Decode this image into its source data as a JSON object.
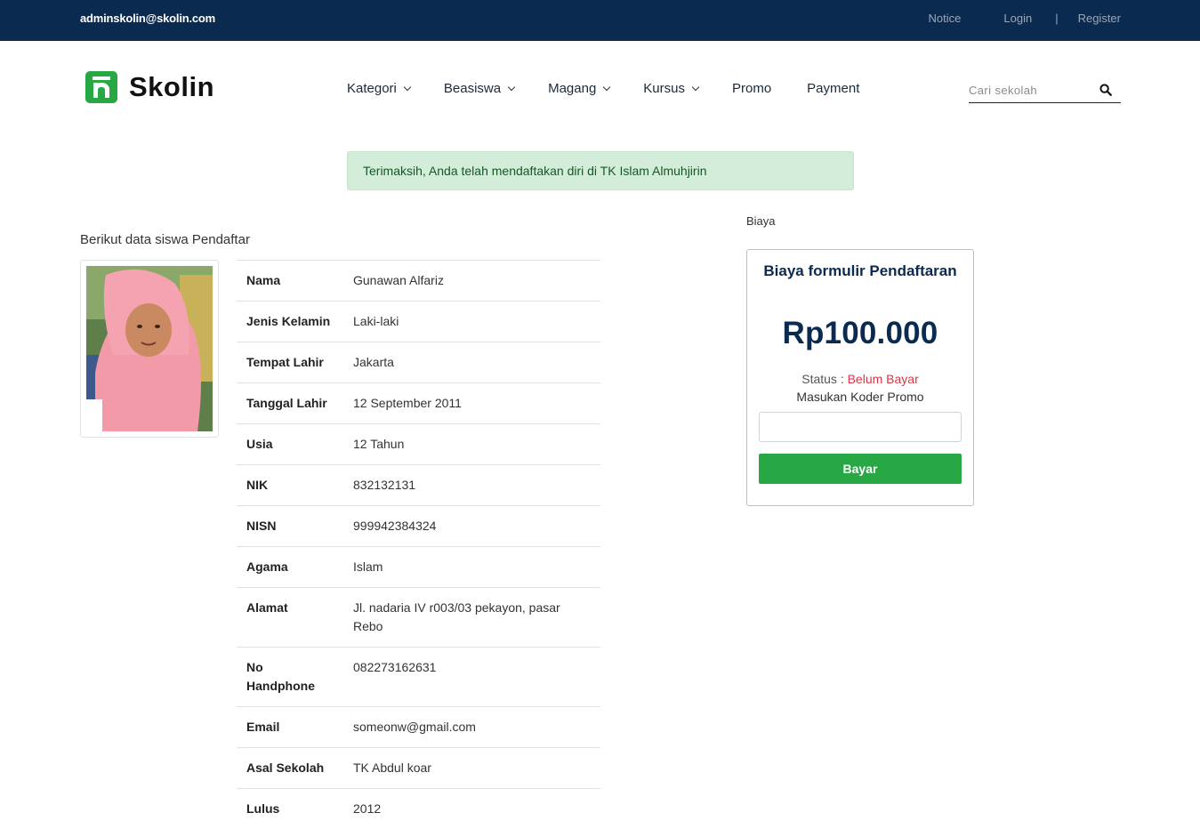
{
  "topbar": {
    "email": "adminskolin@skolin.com",
    "notice": "Notice",
    "login": "Login",
    "separator": "|",
    "register": "Register"
  },
  "logo": {
    "text": "Skolin"
  },
  "nav": {
    "kategori": "Kategori",
    "beasiswa": "Beasiswa",
    "magang": "Magang",
    "kursus": "Kursus",
    "promo": "Promo",
    "payment": "Payment"
  },
  "search": {
    "placeholder": "Cari sekolah"
  },
  "alert": {
    "message": "Terimaksih, Anda telah mendaftakan diri di TK Islam Almuhjirin"
  },
  "student": {
    "title": "Berikut data siswa Pendaftar",
    "rows": [
      {
        "label": "Nama",
        "value": "Gunawan Alfariz"
      },
      {
        "label": "Jenis Kelamin",
        "value": "Laki-laki"
      },
      {
        "label": "Tempat Lahir",
        "value": "Jakarta"
      },
      {
        "label": "Tanggal Lahir",
        "value": "12 September 2011"
      },
      {
        "label": "Usia",
        "value": "12 Tahun"
      },
      {
        "label": "NIK",
        "value": "832132131"
      },
      {
        "label": "NISN",
        "value": "999942384324"
      },
      {
        "label": "Agama",
        "value": "Islam"
      },
      {
        "label": "Alamat",
        "value": "Jl. nadaria IV r003/03 pekayon, pasar Rebo"
      },
      {
        "label": "No Handphone",
        "value": "082273162631"
      },
      {
        "label": "Email",
        "value": "someonw@gmail.com"
      },
      {
        "label": "Asal Sekolah",
        "value": "TK Abdul koar"
      },
      {
        "label": "Lulus",
        "value": "2012"
      }
    ]
  },
  "fee": {
    "section_label": "Biaya",
    "card_title": "Biaya formulir Pendaftaran",
    "price": "Rp100.000",
    "status_label": "Status :",
    "status_value": "Belum Bayar",
    "promo_label": "Masukan Koder Promo",
    "promo_value": "",
    "pay_button": "Bayar"
  },
  "colors": {
    "topbar": "#0b2a4f",
    "brand_green": "#27a844",
    "button_green": "#28a745",
    "status_red": "#dc3545",
    "alert_bg": "#d4edda"
  }
}
